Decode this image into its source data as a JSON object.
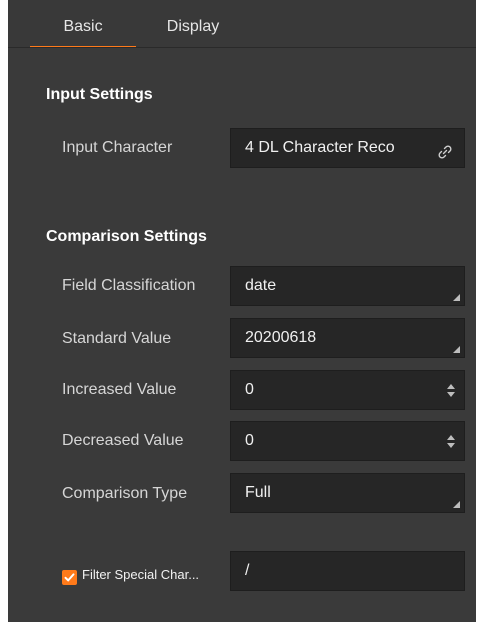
{
  "tabs": [
    {
      "label": "Basic",
      "active": true
    },
    {
      "label": "Display",
      "active": false
    }
  ],
  "input_settings": {
    "title": "Input Settings",
    "input_character": {
      "label": "Input Character",
      "value": "4 DL Character Reco",
      "icon": "link-icon"
    }
  },
  "comparison_settings": {
    "title": "Comparison Settings",
    "field_classification": {
      "label": "Field Classification",
      "value": "date"
    },
    "standard_value": {
      "label": "Standard Value",
      "value": "20200618"
    },
    "increased_value": {
      "label": "Increased Value",
      "value": "0"
    },
    "decreased_value": {
      "label": "Decreased Value",
      "value": "0"
    },
    "comparison_type": {
      "label": "Comparison Type",
      "value": "Full"
    }
  },
  "filter": {
    "checked": true,
    "label": "Filter Special Char...",
    "value": "/"
  },
  "colors": {
    "accent": "#ff7a1a",
    "panel_bg": "#3a3a3a",
    "field_bg": "#262626"
  }
}
